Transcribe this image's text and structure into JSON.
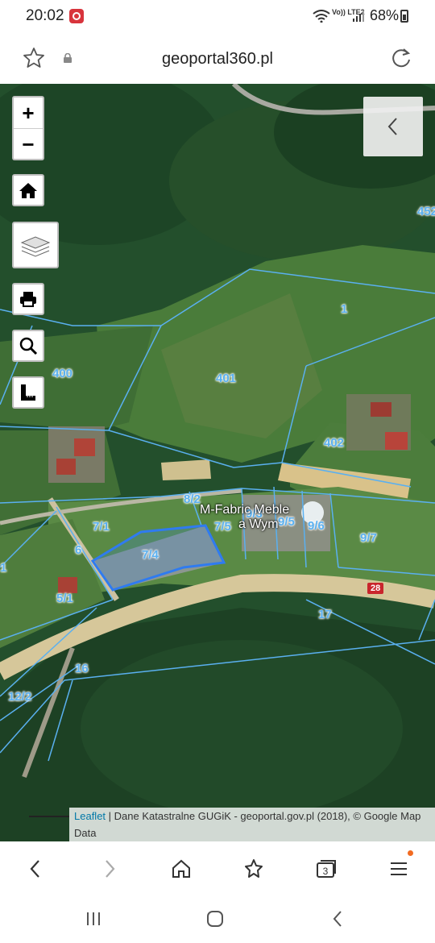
{
  "status": {
    "time": "20:02",
    "network": "Vo)) LTE2",
    "battery": "68%"
  },
  "browser": {
    "url": "geoportal360.pl"
  },
  "map": {
    "controls": {
      "zoom_in": "+",
      "zoom_out": "−"
    },
    "parcel_labels": [
      "452",
      "1",
      "400",
      "401",
      "402",
      "8/2",
      "7/1",
      "7/5",
      "9/3",
      "9/5",
      "9/6",
      "9/7",
      "7/4",
      "6",
      "1",
      "5/1",
      "17",
      "16",
      "12/2"
    ],
    "poi_labels": [
      "M-Fabric Meble",
      "a Wym"
    ],
    "road_number": "28",
    "attribution": {
      "link": "Leaflet",
      "text": " | Dane Katastralne GUGiK - geoportal.gov.pl (2018), © Google Map Data"
    }
  },
  "bottom_nav": {
    "tabs_count": "3"
  }
}
